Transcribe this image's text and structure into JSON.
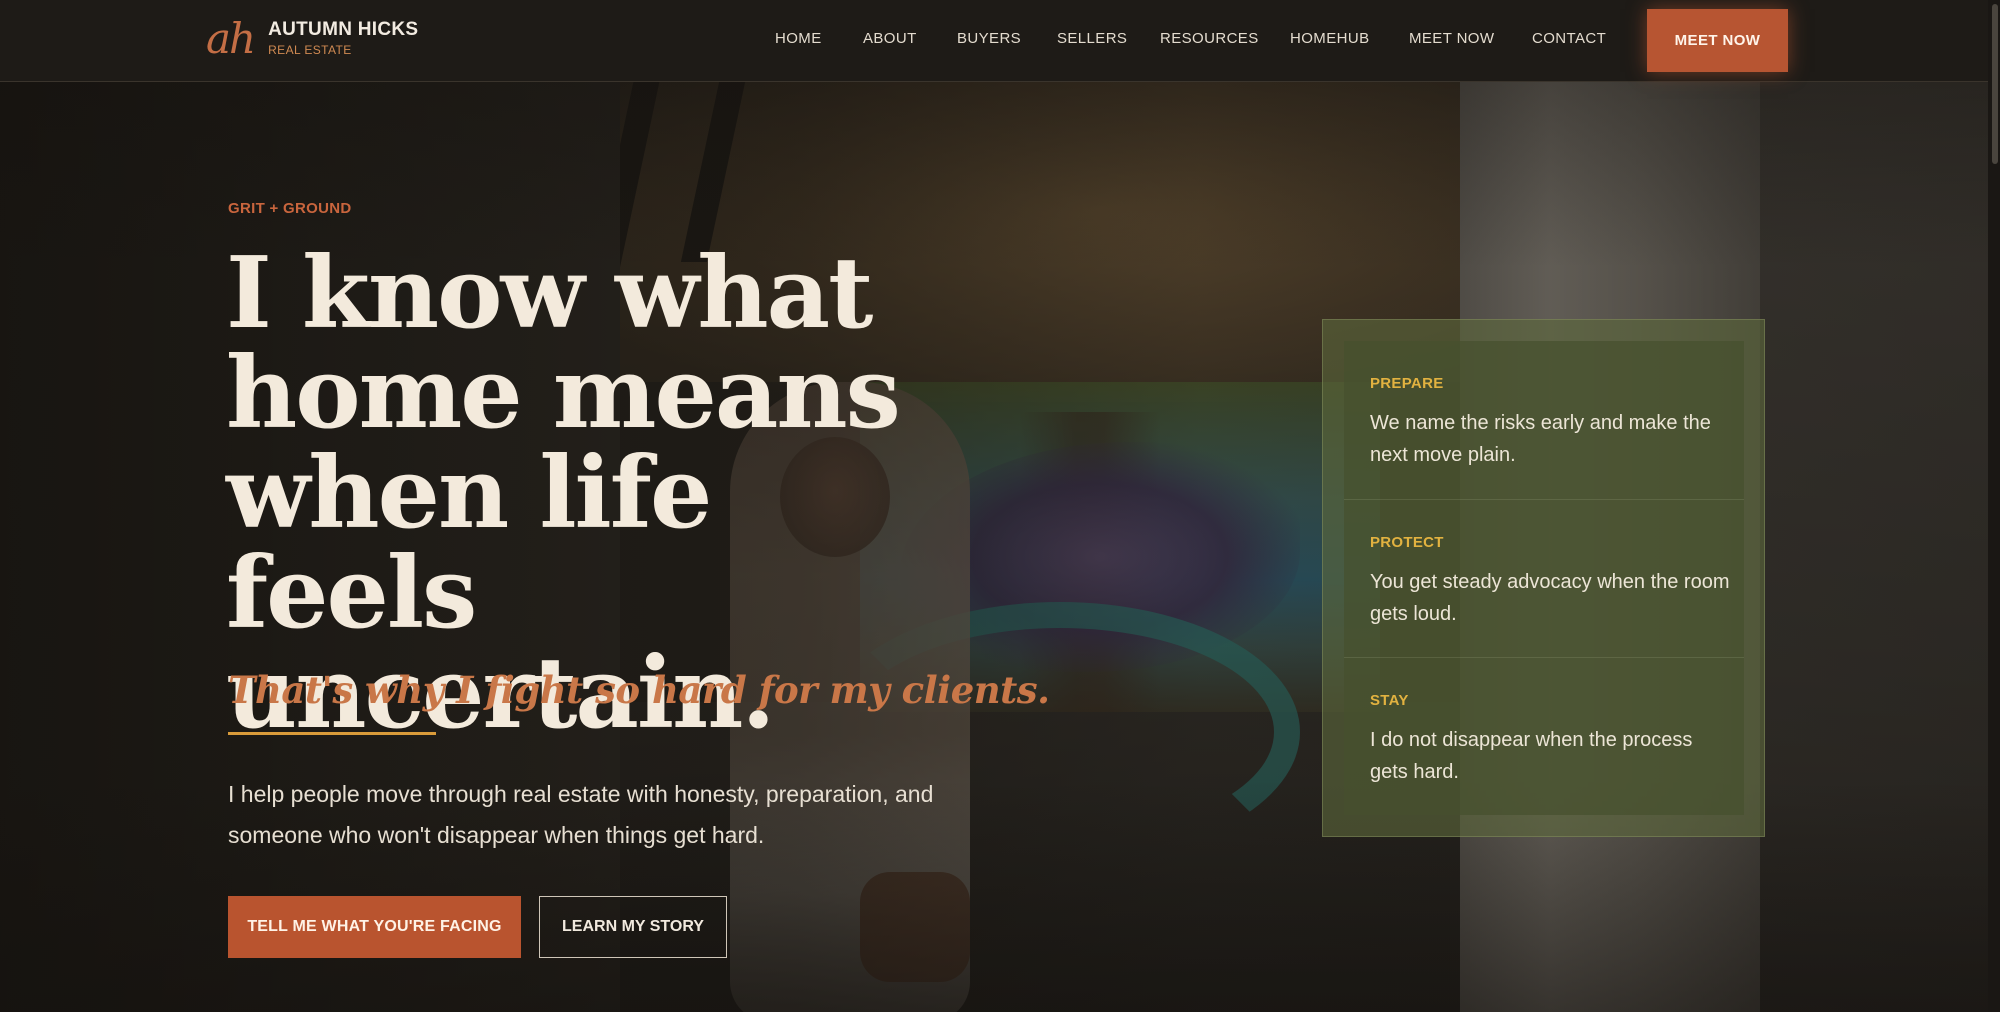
{
  "brand": {
    "mark": "ah",
    "name": "AUTUMN HICKS",
    "sub": "REAL ESTATE"
  },
  "nav": {
    "links": [
      "HOME",
      "ABOUT",
      "BUYERS",
      "SELLERS",
      "RESOURCES",
      "HOMEHUB",
      "MEET NOW",
      "CONTACT"
    ],
    "cta": "MEET NOW"
  },
  "hero": {
    "eyebrow": "GRIT + GROUND",
    "headline": "I know what home means when life feels uncertain.",
    "tagline": "That's why I fight so hard for my clients.",
    "intro": "I help people move through real estate with honesty, preparation, and someone who won't disappear when things get hard.",
    "primary_button": "TELL ME WHAT YOU'RE FACING",
    "secondary_button": "LEARN MY STORY"
  },
  "pillars": [
    {
      "title": "PREPARE",
      "body": "We name the risks early and make the next move plain."
    },
    {
      "title": "PROTECT",
      "body": "You get steady advocacy when the room gets loud."
    },
    {
      "title": "STAY",
      "body": "I do not disappear when the process gets hard."
    }
  ],
  "colors": {
    "accent": "#b9542f",
    "accent_text": "#c97748",
    "gold": "#e2b240",
    "nav_bg": "#1e1b17",
    "card_bg": "#5c683c"
  }
}
